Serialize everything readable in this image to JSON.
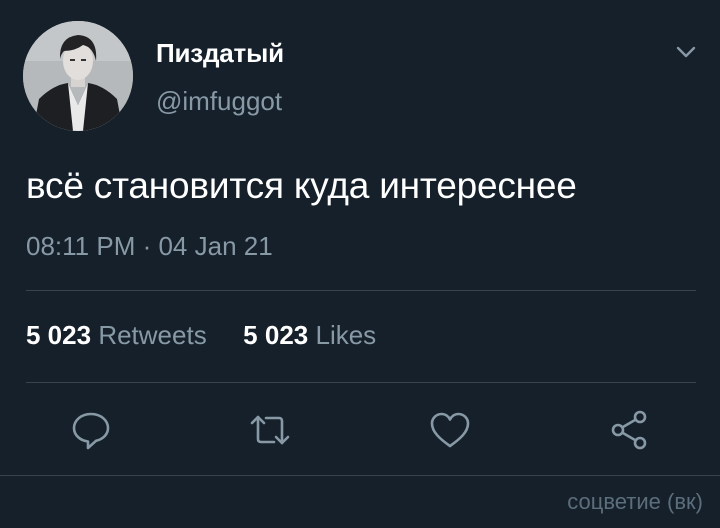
{
  "tweet": {
    "author": {
      "display_name": "Пиздатый",
      "handle": "@imfuggot",
      "avatar": "avatar-photo"
    },
    "text": "всё становится куда интереснее",
    "meta": "08:11 PM · 04 Jan 21",
    "stats": {
      "retweets_count": "5 023",
      "retweets_label": "Retweets",
      "likes_count": "5 023",
      "likes_label": "Likes"
    },
    "actions": [
      {
        "name": "reply",
        "icon": "reply-icon"
      },
      {
        "name": "retweet",
        "icon": "retweet-icon"
      },
      {
        "name": "like",
        "icon": "heart-icon"
      },
      {
        "name": "share",
        "icon": "share-icon"
      }
    ],
    "menu_icon": "chevron-down-icon"
  },
  "watermark": "соцветие (вк)",
  "colors": {
    "background": "#15202b",
    "primary_text": "#ffffff",
    "secondary_text": "#8899a6",
    "divider": "#38444d"
  }
}
